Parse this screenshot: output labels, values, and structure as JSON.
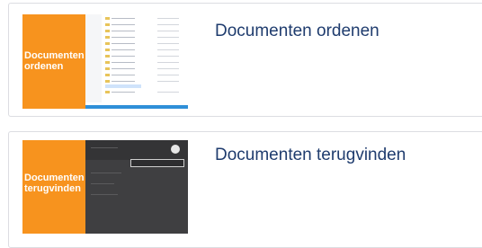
{
  "items": [
    {
      "thumb_text": "Documenten ordenen",
      "title": "Documenten ordenen"
    },
    {
      "thumb_text": "Documenten terugvinden",
      "title": "Documenten terugvinden"
    }
  ],
  "colors": {
    "accent_orange": "#f7931e",
    "title_blue": "#1f3c6e",
    "card_border": "#dcdde2",
    "dark_app": "#3f3f41"
  }
}
